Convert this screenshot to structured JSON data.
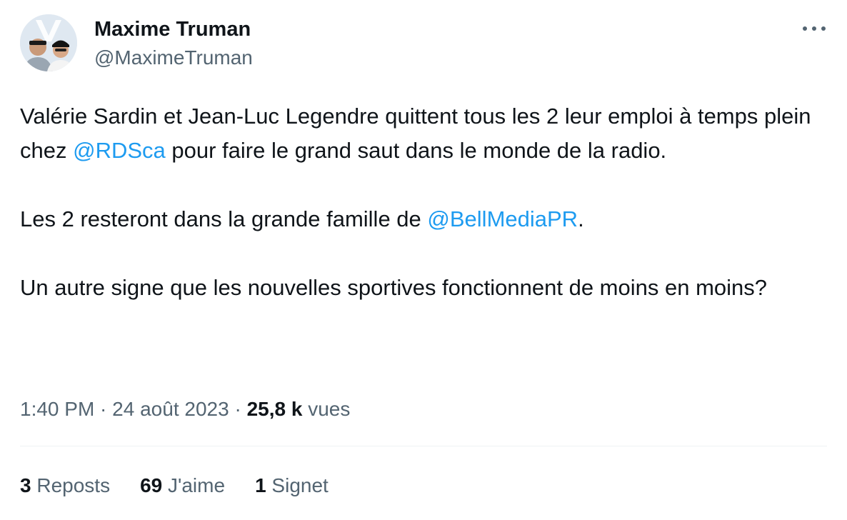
{
  "author": {
    "name": "Maxime Truman",
    "handle": "@MaximeTruman",
    "avatar_icon": "user-avatar-photo"
  },
  "menu": {
    "icon": "more-horizontal-icon",
    "glyph": "···"
  },
  "tweet": {
    "p1_a": "Valérie Sardin et Jean-Luc Legendre quittent tous les 2 leur emploi à temps plein chez ",
    "p1_mention": "@RDSca",
    "p1_b": " pour faire le grand saut dans le monde de la radio.",
    "p2_a": "Les 2 resteront dans la grande famille de ",
    "p2_mention": "@BellMediaPR",
    "p2_b": ".",
    "p3": "Un autre signe que les nouvelles sportives fonctionnent de moins en moins?"
  },
  "meta": {
    "time": "1:40 PM",
    "sep1": " · ",
    "date": "24 août 2023",
    "sep2": " · ",
    "views_count": "25,8 k",
    "views_label": " vues"
  },
  "stats": {
    "reposts_count": "3",
    "reposts_label": " Reposts",
    "likes_count": "69",
    "likes_label": " J'aime",
    "bookmarks_count": "1",
    "bookmarks_label": " Signet"
  },
  "colors": {
    "text": "#0f1419",
    "secondary": "#536471",
    "link": "#1d9bf0",
    "divider": "#eff3f4"
  }
}
